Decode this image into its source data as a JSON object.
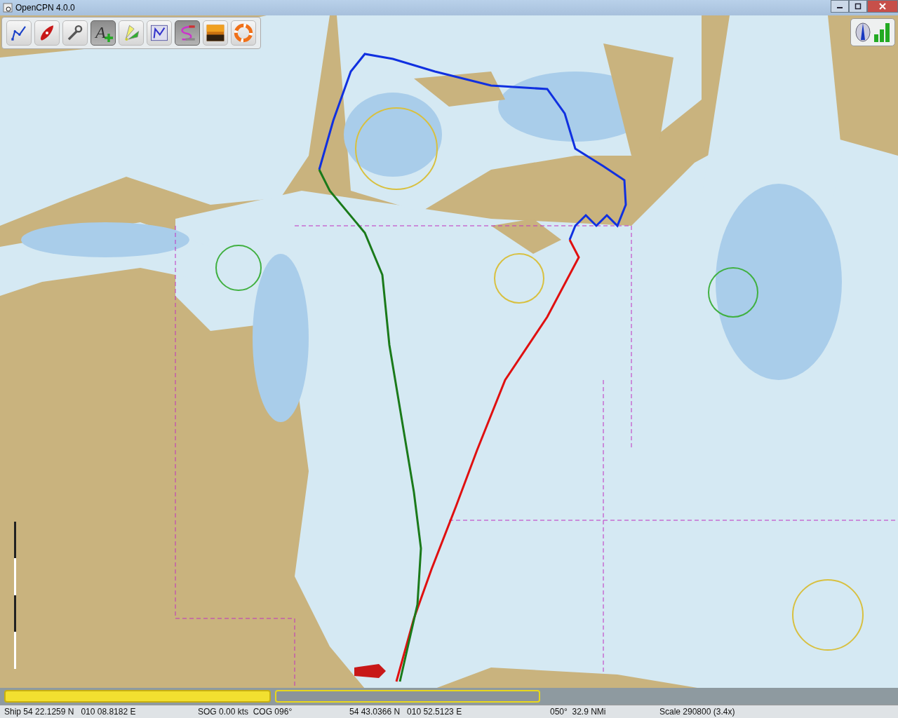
{
  "window": {
    "title": "OpenCPN 4.0.0"
  },
  "toolbar": [
    {
      "kind": "route",
      "on": false
    },
    {
      "kind": "ship",
      "on": false
    },
    {
      "kind": "tools",
      "on": false
    },
    {
      "kind": "text",
      "on": true,
      "label": "A"
    },
    {
      "kind": "lights",
      "on": false
    },
    {
      "kind": "routes_manager",
      "on": false
    },
    {
      "kind": "track",
      "on": true
    },
    {
      "kind": "color_scheme",
      "on": false
    },
    {
      "kind": "mob",
      "on": false
    }
  ],
  "chart_bar": [
    {
      "selected": true
    },
    {
      "selected": false
    }
  ],
  "status_bar": [
    "Ship 54 22.1259 N   010 08.8182 E",
    "SOG 0.00 kts  COG 096°",
    "54 43.0366 N   010 52.5123 E",
    "050°  32.9 NMi",
    "Scale 290800 (3.4x)"
  ]
}
